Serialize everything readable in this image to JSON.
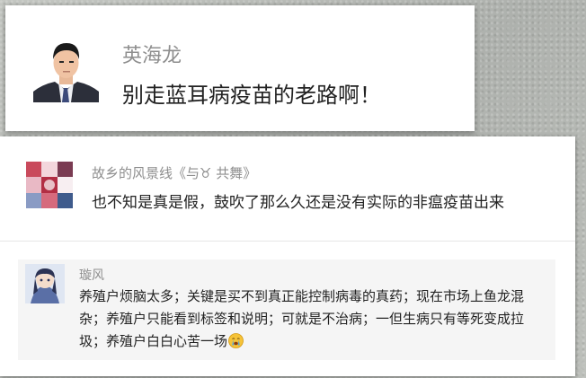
{
  "top_comment": {
    "author": "英海龙",
    "text": "别走蓝耳病疫苗的老路啊！"
  },
  "mid_comment": {
    "author": "故乡的风景线《与♉ 共舞》",
    "text": "也不知是真是假，鼓吹了那么久还是没有实际的非瘟疫苗出来"
  },
  "reply": {
    "author": "璇风",
    "text": "养殖户烦脑太多；关键是买不到真正能控制病毒的真药；现在市场上鱼龙混杂；养殖户只能看到标签和说明；可就是不治病；一但生病只有等死变成拉圾；养殖户白白心苦一场",
    "emoji_icon": "crying-face-icon"
  }
}
